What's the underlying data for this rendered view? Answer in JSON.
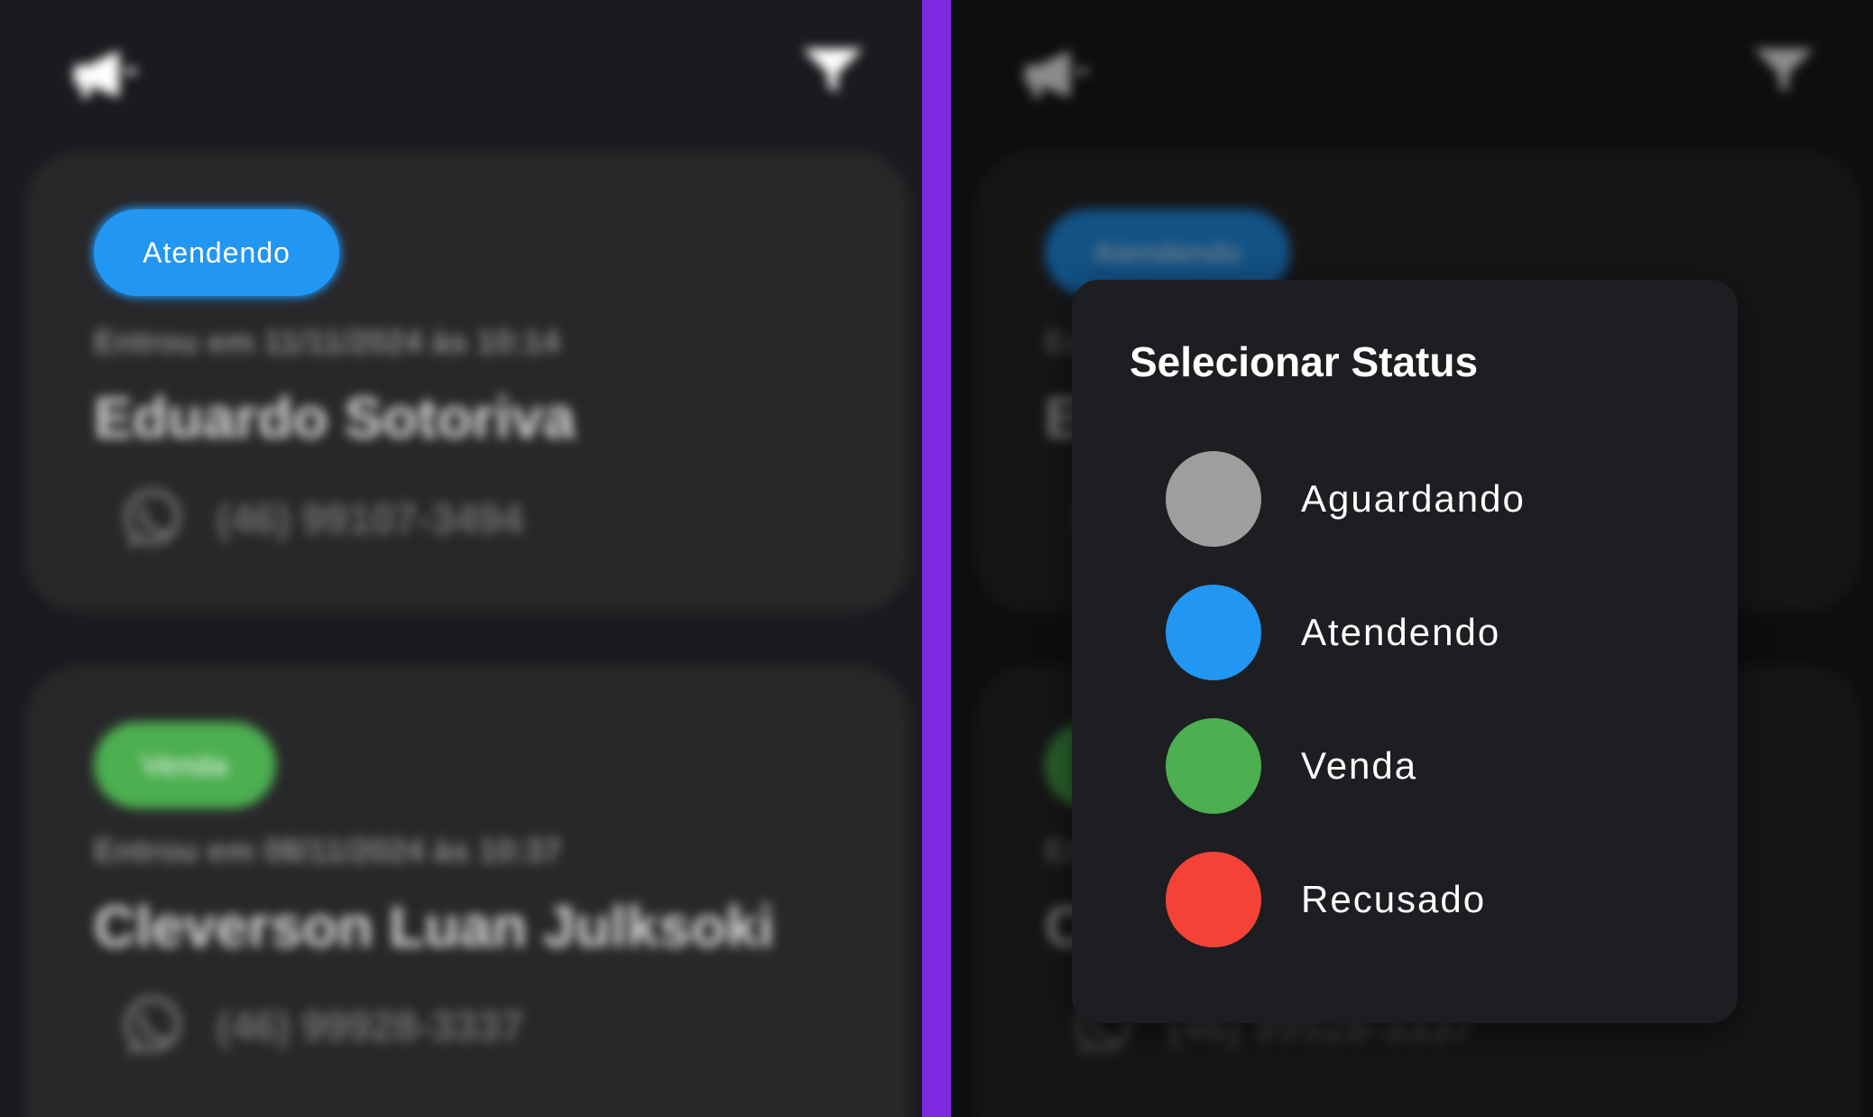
{
  "colors": {
    "divider": "#7d2ae0",
    "aguardando": "#9e9e9e",
    "atendendo": "#2196f3",
    "venda": "#4caf50",
    "recusado": "#f44336"
  },
  "header": {
    "left_icon": "megaphone-icon",
    "right_icon": "filter-icon"
  },
  "leads": [
    {
      "status": "Atendendo",
      "status_color": "#2196f3",
      "entered": "Entrou em 11/11/2024 às 10:14",
      "name": "Eduardo Sotoriva",
      "phone": "(46) 99107-3494",
      "phone_icon": "whatsapp-icon"
    },
    {
      "status": "Venda",
      "status_color": "#4caf50",
      "entered": "Entrou em 08/11/2024 às 10:37",
      "name": "Cleverson Luan Julksoki",
      "phone": "(46) 99928-3337",
      "phone_icon": "whatsapp-icon"
    }
  ],
  "dialog": {
    "title": "Selecionar Status",
    "options": [
      {
        "label": "Aguardando",
        "color": "#9e9e9e"
      },
      {
        "label": "Atendendo",
        "color": "#2196f3"
      },
      {
        "label": "Venda",
        "color": "#4caf50"
      },
      {
        "label": "Recusado",
        "color": "#f44336"
      }
    ]
  }
}
